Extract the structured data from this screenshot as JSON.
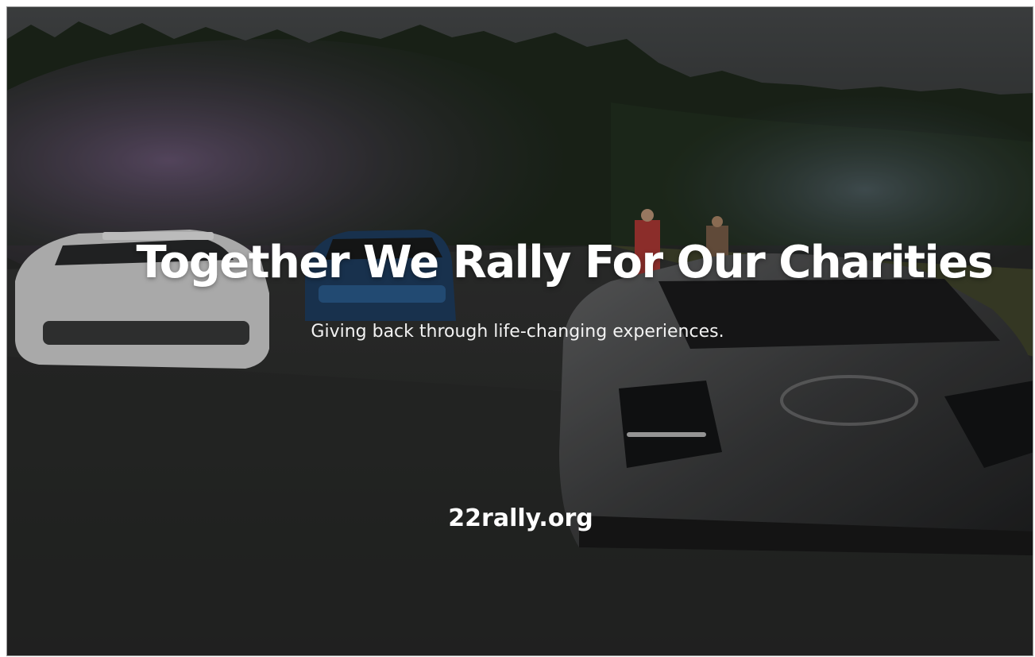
{
  "hero": {
    "headline": "Together We Rally For Our Charities",
    "subheadline": "Giving back through life-changing experiences.",
    "website": "22rally.org"
  },
  "colors": {
    "overlay": "#000000",
    "text": "#ffffff",
    "track": "#3b3c3b",
    "trees": "#1e2a1c",
    "smoke": "#6b5676"
  }
}
